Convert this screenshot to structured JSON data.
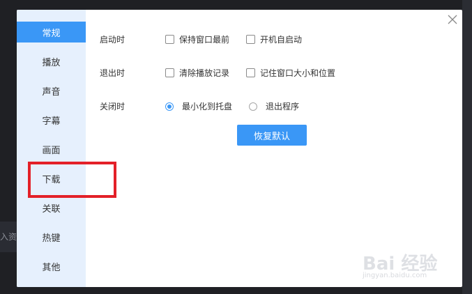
{
  "background": {
    "left_text": "入资源"
  },
  "sidebar": {
    "items": [
      {
        "label": "常规",
        "active": true
      },
      {
        "label": "播放"
      },
      {
        "label": "声音"
      },
      {
        "label": "字幕"
      },
      {
        "label": "画面"
      },
      {
        "label": "下载"
      },
      {
        "label": "关联"
      },
      {
        "label": "热键"
      },
      {
        "label": "其他"
      }
    ]
  },
  "settings": {
    "startup": {
      "label": "启动时",
      "options": [
        {
          "label": "保持窗口最前",
          "checked": false
        },
        {
          "label": "开机自启动",
          "checked": false
        }
      ]
    },
    "exit": {
      "label": "退出时",
      "options": [
        {
          "label": "清除播放记录",
          "checked": false
        },
        {
          "label": "记住窗口大小和位置",
          "checked": false
        }
      ]
    },
    "close": {
      "label": "关闭时",
      "options": [
        {
          "label": "最小化到托盘",
          "selected": true
        },
        {
          "label": "退出程序",
          "selected": false
        }
      ]
    },
    "restore_label": "恢复默认"
  },
  "watermark": {
    "logo": "Bai 经验",
    "url": "jingyan.baidu.com"
  },
  "colors": {
    "accent": "#3a97f6",
    "sidebar_bg": "#e6f0fd",
    "highlight": "#e32028"
  }
}
